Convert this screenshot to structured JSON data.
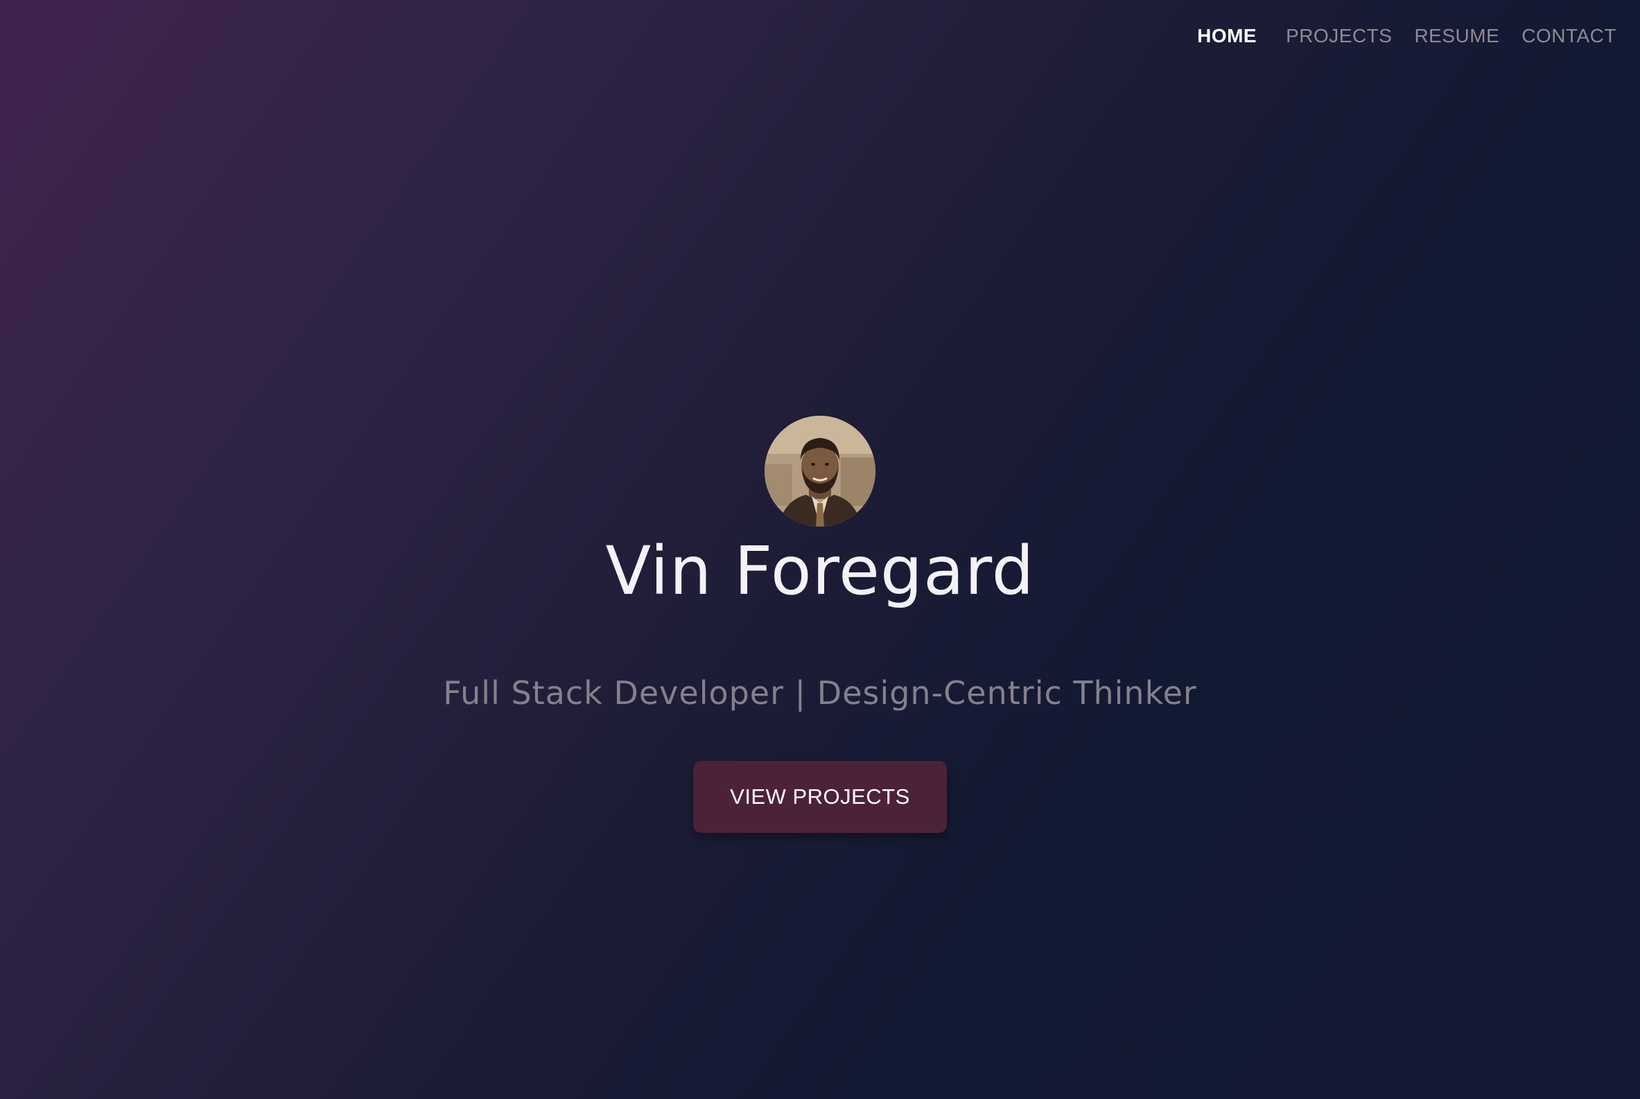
{
  "nav": {
    "items": [
      {
        "label": "HOME",
        "active": true
      },
      {
        "label": "PROJECTS",
        "active": false
      },
      {
        "label": "RESUME",
        "active": false
      },
      {
        "label": "CONTACT",
        "active": false
      }
    ]
  },
  "hero": {
    "avatar_icon": "profile-photo",
    "name": "Vin Foregard",
    "subtitle": "Full Stack Developer | Design-Centric Thinker",
    "cta_label": "VIEW PROJECTS"
  },
  "colors": {
    "cta_background": "#4c2239",
    "nav_active": "#ffffff",
    "nav_inactive": "#8f8a92"
  }
}
